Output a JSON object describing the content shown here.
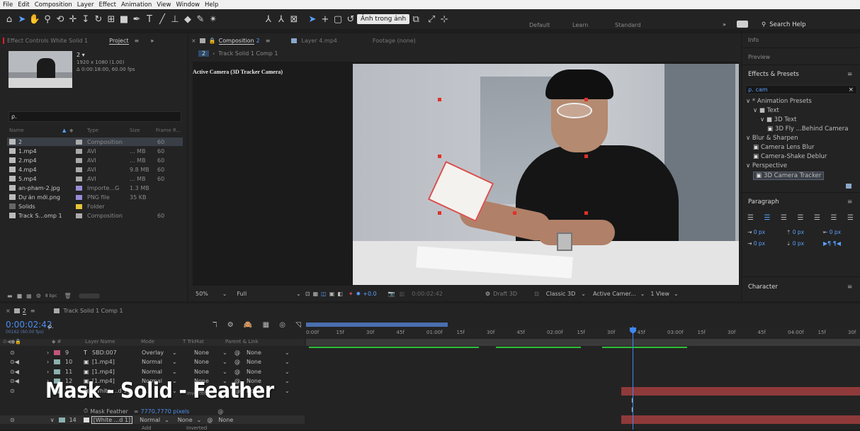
{
  "menu": [
    "File",
    "Edit",
    "Composition",
    "Layer",
    "Effect",
    "Animation",
    "View",
    "Window",
    "Help"
  ],
  "toolbar": {
    "tooltip": "Ảnh trong ảnh",
    "workspaces": [
      "Default",
      "Learn",
      "Standard"
    ],
    "chevron": "»",
    "search_help": "Search Help"
  },
  "left_tabs": {
    "effect_controls": "Effect Controls White Solid 1",
    "project": "Project",
    "project_menu": "≡",
    "more": "»"
  },
  "project": {
    "thumb_name": "2 ▾",
    "thumb_info1": "1920 x 1080 (1.00)",
    "thumb_info2": "Δ 0:00:18:00, 60.00 fps",
    "search_icon_text": "ρ.",
    "headers": [
      "Name",
      "Type",
      "Size",
      "Frame R..."
    ],
    "items": [
      {
        "name": "2",
        "type": "Composition",
        "size": "",
        "fr": "60",
        "color": "#aaaaaa",
        "selected": true
      },
      {
        "name": "1.mp4",
        "type": "AVI",
        "size": "... MB",
        "fr": "60",
        "color": "#aaaaaa"
      },
      {
        "name": "2.mp4",
        "type": "AVI",
        "size": "... MB",
        "fr": "60",
        "color": "#aaaaaa"
      },
      {
        "name": "4.mp4",
        "type": "AVI",
        "size": "9.8 MB",
        "fr": "60",
        "color": "#aaaaaa"
      },
      {
        "name": "5.mp4",
        "type": "AVI",
        "size": "... MB",
        "fr": "60",
        "color": "#aaaaaa"
      },
      {
        "name": "an-pham-2.jpg",
        "type": "Importe...G",
        "size": "1.3 MB",
        "fr": "",
        "color": "#9b8bd6"
      },
      {
        "name": "Dự án mới.png",
        "type": "PNG file",
        "size": "35 KB",
        "fr": "",
        "color": "#9b8bd6"
      },
      {
        "name": "Solids",
        "type": "Folder",
        "size": "",
        "fr": "",
        "color": "#e8c43a"
      },
      {
        "name": "Track S...omp 1",
        "type": "Composition",
        "size": "",
        "fr": "60",
        "color": "#aaaaaa"
      }
    ],
    "bpc": "8 bpc"
  },
  "comp": {
    "tab_label": "Composition",
    "tab_num": "2",
    "tab_menu": "≡",
    "layer_tab": "Layer 4.mp4",
    "footage_tab": "Footage (none)",
    "breadcrumb_a": "2",
    "breadcrumb_b": "Track Solid 1 Comp 1",
    "camera_label": "Active Camera (3D Tracker Camera)",
    "footer": {
      "zoom": "50%",
      "res": "Full",
      "exposure": "+0.0",
      "timecode": "0:00:02:42",
      "draft": "Draft 3D",
      "renderer": "Classic 3D",
      "view": "Active Camer...",
      "views": "1 View"
    }
  },
  "right": {
    "info": "Info",
    "preview": "Preview",
    "effects_title": "Effects & Presets",
    "search_value": "cam",
    "tree": [
      {
        "text": "∨ * Animation Presets",
        "indent": 0
      },
      {
        "text": "∨ ■ Text",
        "indent": 1
      },
      {
        "text": "∨ ■ 3D Text",
        "indent": 2
      },
      {
        "text": "3D Fly ...Behind Camera",
        "indent": 3
      },
      {
        "text": "∨ Blur & Sharpen",
        "indent": 0
      },
      {
        "text": "Camera Lens Blur",
        "indent": 1
      },
      {
        "text": "Camera-Shake Deblur",
        "indent": 1
      },
      {
        "text": "∨ Perspective",
        "indent": 0
      },
      {
        "text": "3D Camera Tracker",
        "indent": 1,
        "selected": true
      }
    ],
    "paragraph": "Paragraph",
    "para_vals": [
      "0 px",
      "0 px",
      "0 px",
      "0 px",
      "0 px"
    ],
    "character": "Character"
  },
  "timeline": {
    "comp_tab": "2",
    "comp_tab_menu": "≡",
    "other_tab": "Track Solid 1 Comp 1",
    "timecode": "0:00:02:42",
    "frames": "00162 (60.00 fps)",
    "search_icon_text": "ρ.",
    "headers": [
      "Layer Name",
      "Mode",
      "T TrkMat",
      "Parent & Link"
    ],
    "layers": [
      {
        "num": "9",
        "name": "SBD:007",
        "mode": "Overlay",
        "trk": "None",
        "parent": "None",
        "type": "T"
      },
      {
        "num": "10",
        "name": "[1.mp4]",
        "mode": "Normal",
        "trk": "None",
        "parent": "None",
        "type": "v"
      },
      {
        "num": "11",
        "name": "[1.mp4]",
        "mode": "Normal",
        "trk": "None",
        "parent": "None",
        "type": "v"
      },
      {
        "num": "12",
        "name": "[1.mp4]",
        "mode": "Normal",
        "trk": "None",
        "parent": "None",
        "type": "v"
      },
      {
        "num": "13",
        "name": "[White ...d 1]",
        "mode": "N...",
        "trk": "None",
        "parent": "None",
        "type": "s"
      }
    ],
    "inverted": "Inverted",
    "mask_feather": "Mask Feather",
    "mask_feather_val": "7770,7770 pixels",
    "layer14": {
      "num": "14",
      "name": "[White ...d 1]",
      "mode": "Normal",
      "trk": "None",
      "parent": "None"
    },
    "add": "Add",
    "inverted2": "Inverted",
    "ticks": [
      "0:00f",
      "15f",
      "30f",
      "45f",
      "01:00f",
      "15f",
      "30f",
      "45f",
      "02:00f",
      "15f",
      "30f",
      "45f",
      "03:00f",
      "15f",
      "30f",
      "45f",
      "04:00f",
      "15f",
      "30f"
    ],
    "overlay_text": "Mask - Solid - Feather"
  }
}
